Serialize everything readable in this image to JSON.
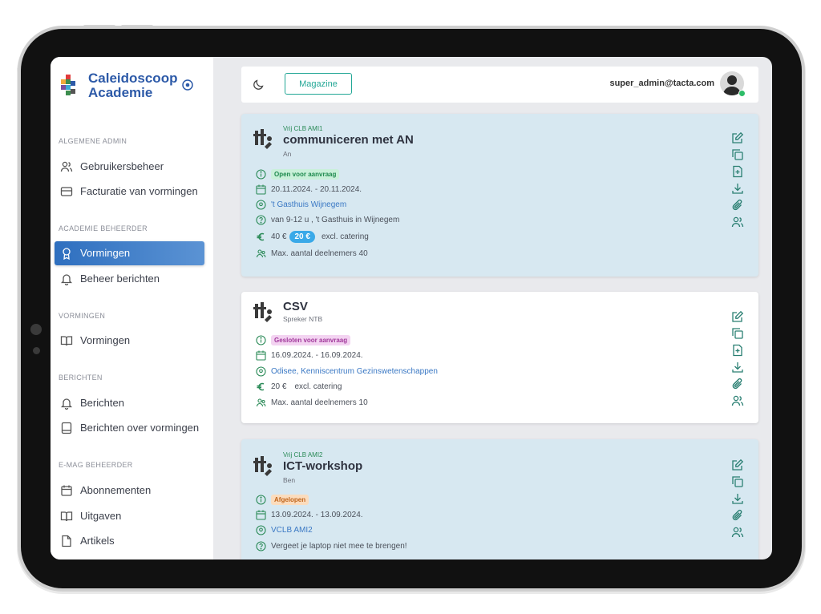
{
  "brand": {
    "name_line1": "Caleidoscoop",
    "name_line2": "Academie"
  },
  "colors": {
    "brand": "#2d5aa8",
    "accent": "#23a796",
    "active_nav": "#2e6fbf",
    "card_blue": "#d7e8f1"
  },
  "sidebar": {
    "sections": [
      {
        "title": "ALGEMENE ADMIN",
        "items": [
          {
            "label": "Gebruikersbeheer",
            "icon": "users-icon"
          },
          {
            "label": "Facturatie van vormingen",
            "icon": "credit-card-icon"
          }
        ]
      },
      {
        "title": "ACADEMIE BEHEERDER",
        "items": [
          {
            "label": "Vormingen",
            "icon": "award-icon",
            "active": true
          },
          {
            "label": "Beheer berichten",
            "icon": "bell-icon"
          }
        ]
      },
      {
        "title": "VORMINGEN",
        "items": [
          {
            "label": "Vormingen",
            "icon": "book-icon"
          }
        ]
      },
      {
        "title": "BERICHTEN",
        "items": [
          {
            "label": "Berichten",
            "icon": "bell-icon"
          },
          {
            "label": "Berichten over vormingen",
            "icon": "tablet-icon"
          }
        ]
      },
      {
        "title": "E-MAG BEHEERDER",
        "items": [
          {
            "label": "Abonnementen",
            "icon": "calendar-icon"
          },
          {
            "label": "Uitgaven",
            "icon": "book-icon"
          },
          {
            "label": "Artikels",
            "icon": "file-icon"
          }
        ]
      }
    ]
  },
  "topbar": {
    "magazine_label": "Magazine",
    "user_email": "super_admin@tacta.com"
  },
  "cards": [
    {
      "pretitle": "Vrij CLB AMI1",
      "title": "communiceren met AN",
      "subtitle": "An",
      "status": "Open voor aanvraag",
      "dates": "20.11.2024. - 20.11.2024.",
      "location": "'t Gasthuis Wijnegem",
      "info": "van 9-12 u , 't Gasthuis in Wijnegem",
      "price": "40 €",
      "price_chip": "20 €",
      "catering": "excl. catering",
      "max_participants": "Max. aantal deelnemers 40"
    },
    {
      "title": "CSV",
      "subtitle": "Spreker NTB",
      "status": "Gesloten voor aanvraag",
      "dates": "16.09.2024. - 16.09.2024.",
      "location": "Odisee, Kenniscentrum Gezinswetenschappen",
      "price": "20 €",
      "catering": "excl. catering",
      "max_participants": "Max. aantal deelnemers 10"
    },
    {
      "pretitle": "Vrij CLB AMI2",
      "title": "ICT-workshop",
      "subtitle": "Ben",
      "status": "Afgelopen",
      "dates": "13.09.2024. - 13.09.2024.",
      "location": "VCLB AMI2",
      "info": "Vergeet je laptop niet mee te brengen!"
    }
  ]
}
